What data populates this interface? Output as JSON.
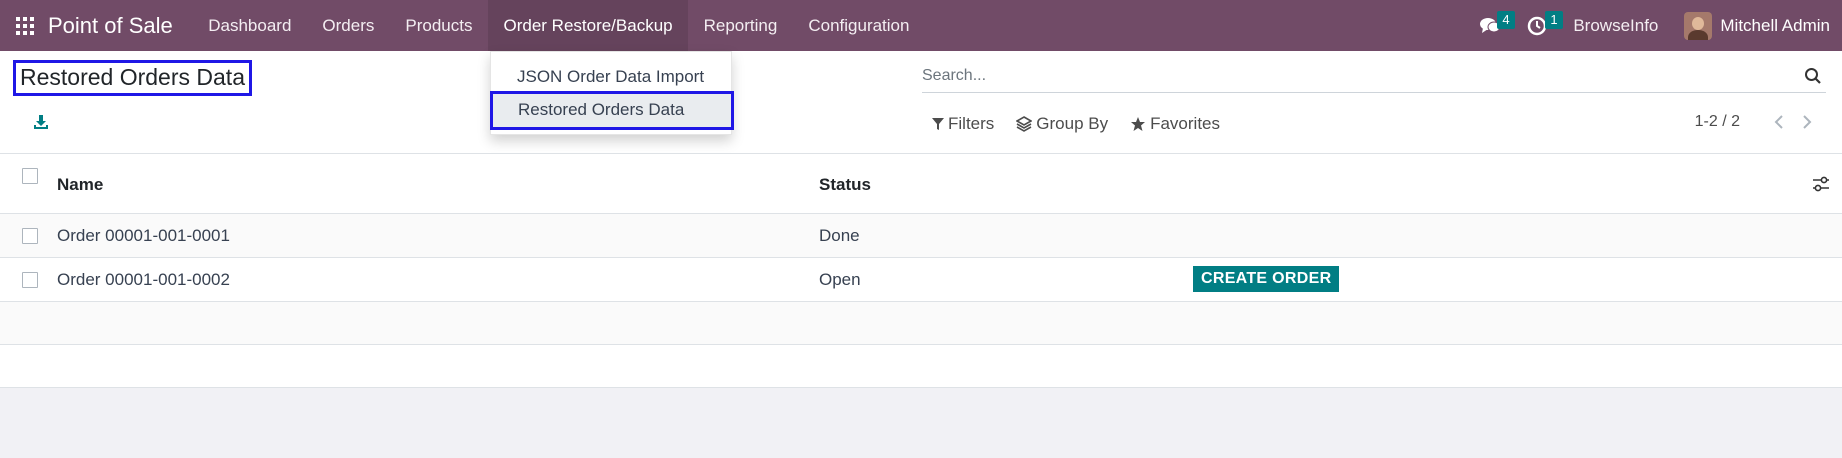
{
  "navbar": {
    "brand": "Point of Sale",
    "menu": [
      "Dashboard",
      "Orders",
      "Products",
      "Order Restore/Backup",
      "Reporting",
      "Configuration"
    ],
    "messages_count": "4",
    "activities_count": "1",
    "company": "BrowseInfo",
    "user": "Mitchell Admin"
  },
  "control_panel": {
    "title": "Restored Orders Data",
    "search_placeholder": "Search...",
    "filters_label": "Filters",
    "group_by_label": "Group By",
    "favorites_label": "Favorites",
    "pager": "1-2 / 2"
  },
  "dropdown": {
    "items": [
      "JSON Order Data Import",
      "Restored Orders Data"
    ]
  },
  "list": {
    "columns": [
      "Name",
      "Status"
    ],
    "rows": [
      {
        "name": "Order 00001-001-0001",
        "status": "Done",
        "action": ""
      },
      {
        "name": "Order 00001-001-0002",
        "status": "Open",
        "action": "CREATE ORDER"
      }
    ]
  },
  "colors": {
    "navbar": "#714b67",
    "accent": "#017e84",
    "highlight_outline": "#1f17e6"
  },
  "icons": [
    "apps-icon",
    "chat-icon",
    "clock-icon",
    "download-icon",
    "search-icon",
    "filter-icon",
    "layers-icon",
    "star-icon",
    "chevron-left-icon",
    "chevron-right-icon",
    "sliders-icon"
  ]
}
